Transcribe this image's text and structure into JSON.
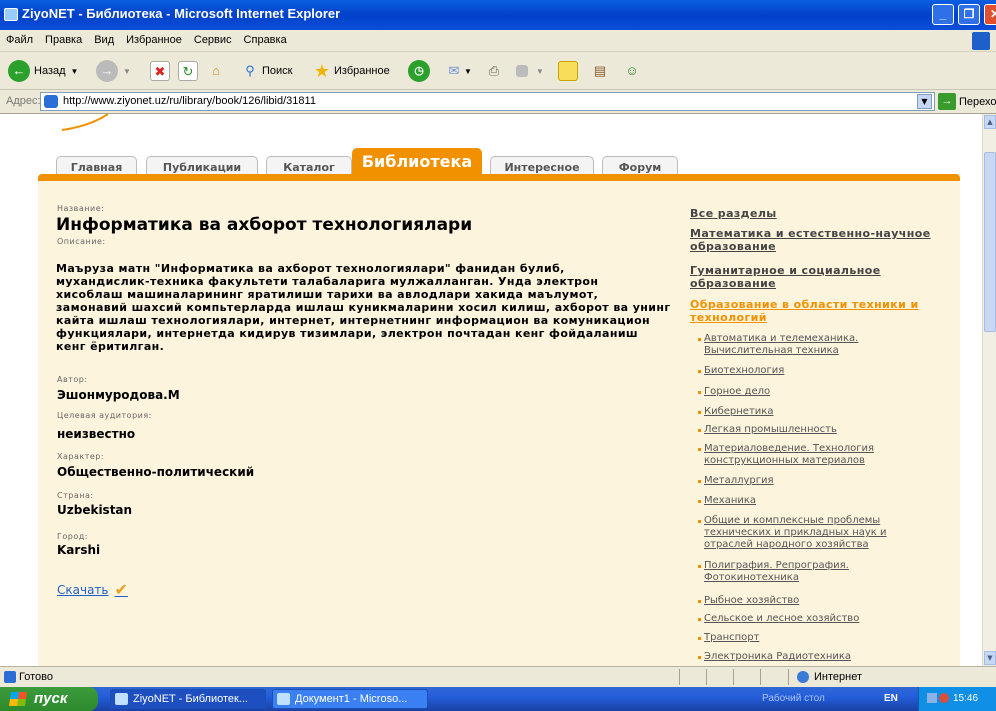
{
  "window": {
    "title": "ZiyoNET - Библиотека - Microsoft Internet Explorer"
  },
  "menu": [
    "Файл",
    "Правка",
    "Вид",
    "Избранное",
    "Сервис",
    "Справка"
  ],
  "toolbar": {
    "back": "Назад",
    "search": "Поиск",
    "favorites": "Избранное"
  },
  "address": {
    "label": "Адрес:",
    "url": "http://www.ziyonet.uz/ru/library/book/126/libid/31811",
    "go": "Переход"
  },
  "tabs": [
    "Главная",
    "Публикации",
    "Каталог",
    "Библиотека",
    "Интересное",
    "Форум"
  ],
  "book": {
    "title_label": "Название:",
    "title": "Информатика ва ахборот технологиялари",
    "desc_label": "Описание:",
    "desc": "Маъруза матн \"Информатика ва ахборот технологиялари\" фанидан булиб,\nмухандислик-техника факультети талабаларига мулжалланган. Унда электрон\nхисоблаш машиналарининг яратилиши тарихи ва авлодлари хакида маълумот,\nзамонавий шахсий компьтерларда ишлаш куникмаларини хосил килиш, ахборот ва унинг\nкайта ишлаш технологиялари, интернет, интернетнинг информацион ва комуникацион\nфункциялари, интернетда кидирув тизимлари, электрон почтадан кенг фойдаланиш\nкенг ёритилган.",
    "author_label": "Автор:",
    "author": "Эшонмуродова.М",
    "audience_label": "Целевая аудитория:",
    "audience": "неизвестно",
    "character_label": "Характер:",
    "character": "Общественно-политический",
    "country_label": "Страна:",
    "country": "Uzbekistan",
    "city_label": "Город:",
    "city": "Karshi",
    "download": "Скачать"
  },
  "categories": {
    "all": "Все разделы",
    "math": "Математика и естественно-научное образование",
    "human": "Гуманитарное и социальное образование",
    "tech": "Образование в области техники и технологий",
    "sub": [
      "Автоматика и телемеханика. Вычислительная техника",
      "Биотехнология",
      "Горное дело",
      "Кибернетика",
      "Легкая промышленность",
      "Материаловедение. Технология конструкционных материалов",
      "Металлургия",
      "Механика",
      "Общие и комплексные проблемы технических и прикладных наук и отраслей народного хозяйства",
      "Полиграфия. Репрография. Фотокинотехника",
      "Рыбное хозяйство",
      "Сельское и лесное хозяйство",
      "Транспорт",
      "Электроника Радиотехника"
    ]
  },
  "status": {
    "left": "Готово",
    "zone": "Интернет"
  },
  "taskbar": {
    "start": "пуск",
    "tasks": [
      "ZiyoNET - Библиотек...",
      "Документ1 - Microso..."
    ],
    "desktop": "Рабочий стол",
    "lang": "EN",
    "time": "15:46"
  },
  "colors": {
    "accent": "#f29100",
    "panel": "#fcf4dd",
    "link": "#1e5ec6"
  }
}
